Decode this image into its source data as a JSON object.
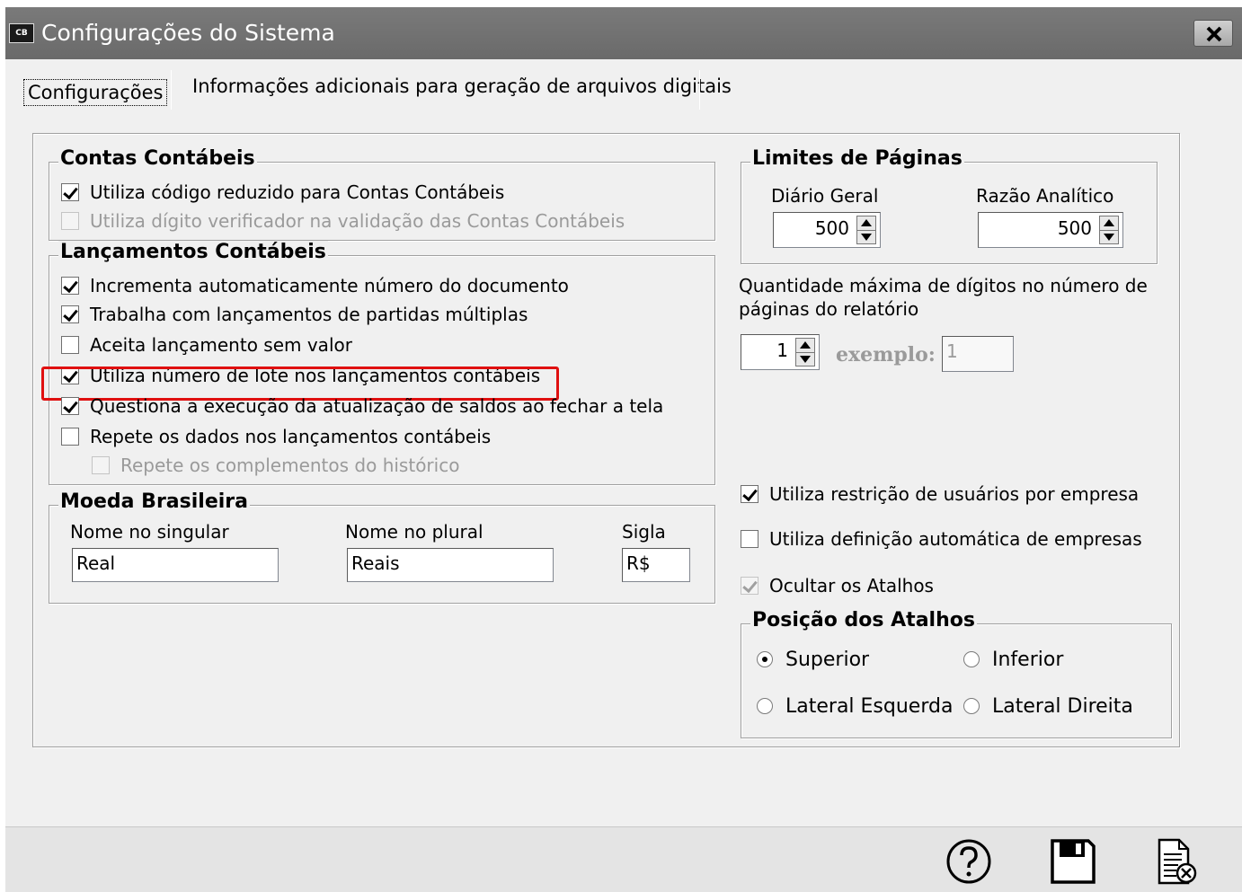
{
  "window": {
    "icon_text": "CB",
    "title": "Configurações do Sistema"
  },
  "tabs": [
    {
      "label": "Configurações",
      "active": true
    },
    {
      "label": "Informações adicionais para geração de arquivos digitais",
      "active": false
    }
  ],
  "contas": {
    "title": "Contas Contábeis",
    "items": [
      {
        "label": "Utiliza código reduzido para Contas Contábeis",
        "checked": true,
        "enabled": true
      },
      {
        "label": "Utiliza dígito verificador na validação das Contas Contábeis",
        "checked": false,
        "enabled": false
      }
    ]
  },
  "lancamentos": {
    "title": "Lançamentos Contábeis",
    "items": [
      {
        "label": "Incrementa automaticamente número do documento",
        "checked": true,
        "enabled": true
      },
      {
        "label": "Trabalha com lançamentos de partidas múltiplas",
        "checked": true,
        "enabled": true
      },
      {
        "label": "Aceita lançamento sem valor",
        "checked": false,
        "enabled": true
      },
      {
        "label": "Utiliza número de lote nos lançamentos contábeis",
        "checked": true,
        "enabled": true
      },
      {
        "label": "Questiona a execução da atualização de saldos ao fechar a tela",
        "checked": true,
        "enabled": true
      },
      {
        "label": "Repete os dados nos lançamentos contábeis",
        "checked": false,
        "enabled": true
      },
      {
        "label": "Repete os complementos do histórico",
        "checked": false,
        "enabled": false
      }
    ]
  },
  "moeda": {
    "title": "Moeda Brasileira",
    "singular_label": "Nome no singular",
    "singular_value": "Real",
    "plural_label": "Nome no plural",
    "plural_value": "Reais",
    "sigla_label": "Sigla",
    "sigla_value": "R$"
  },
  "limites": {
    "title": "Limites de Páginas",
    "diario_label": "Diário Geral",
    "diario_value": "500",
    "razao_label": "Razão Analítico",
    "razao_value": "500"
  },
  "digitos": {
    "label_line1": "Quantidade máxima de dígitos no número de",
    "label_line2": "páginas do relatório",
    "value": "1",
    "exemplo_label": "exemplo:",
    "exemplo_value": "1"
  },
  "opcoes": [
    {
      "label": "Utiliza restrição de usuários por empresa",
      "checked": true,
      "enabled": true
    },
    {
      "label": "Utiliza definição automática de empresas",
      "checked": false,
      "enabled": true
    },
    {
      "label": "Ocultar os Atalhos",
      "checked": true,
      "enabled": false
    }
  ],
  "atalhos": {
    "title": "Posição dos Atalhos",
    "options": [
      {
        "label": "Superior",
        "selected": true
      },
      {
        "label": "Inferior",
        "selected": false
      },
      {
        "label": "Lateral Esquerda",
        "selected": false
      },
      {
        "label": "Lateral Direita",
        "selected": false
      }
    ]
  },
  "footer": {
    "buttons": [
      "help-icon",
      "save-icon",
      "cancel-document-icon"
    ]
  },
  "colors": {
    "highlight": "#e01010",
    "titlebar": "#6e6e6e"
  }
}
